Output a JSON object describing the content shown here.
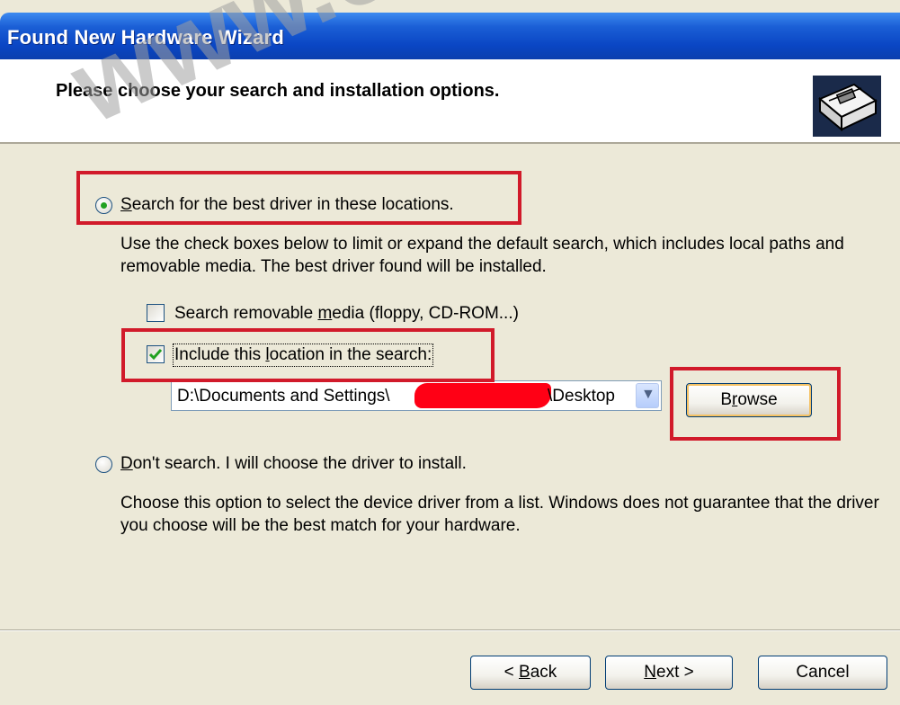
{
  "window": {
    "title": "Found New Hardware Wizard"
  },
  "header": {
    "heading": "Please choose your search and installation options."
  },
  "option_search": {
    "label_prefix": "S",
    "label_rest": "earch for the best driver in these locations.",
    "selected": true,
    "description": "Use the check boxes below to limit or expand the default search, which includes local paths and removable media. The best driver found will be installed."
  },
  "check_removable": {
    "label_prefix": "Search removable ",
    "label_accel": "m",
    "label_rest": "edia (floppy, CD-ROM...)",
    "checked": false
  },
  "check_include": {
    "label_prefix": "Include this ",
    "label_accel": "l",
    "label_rest": "ocation in the search:",
    "checked": true
  },
  "location_combo": {
    "value_start": "D:\\Documents and Settings\\",
    "value_end": "\\Desktop"
  },
  "browse_button": {
    "label_prefix": "B",
    "label_accel": "r",
    "label_rest": "owse"
  },
  "option_dont_search": {
    "label_prefix": "D",
    "label_rest": "on't search. I will choose the driver to install.",
    "selected": false,
    "description": "Choose this option to select the device driver from a list.  Windows does not guarantee that the driver you choose will be the best match for your hardware."
  },
  "footer": {
    "back": {
      "pre": "< ",
      "accel": "B",
      "rest": "ack"
    },
    "next": {
      "accel": "N",
      "rest": "ext >"
    },
    "cancel": "Cancel"
  },
  "watermark": "www.eop",
  "icons": [
    "hardware-card-icon",
    "radio-selected-icon",
    "radio-unselected-icon",
    "checkbox-checked-icon",
    "checkbox-unchecked-icon",
    "chevron-down-icon"
  ],
  "colors": {
    "titlebar": "#0a46c4",
    "dialog_bg": "#ece9d8",
    "highlight": "#d11a2a",
    "redaction": "#ff0015"
  }
}
